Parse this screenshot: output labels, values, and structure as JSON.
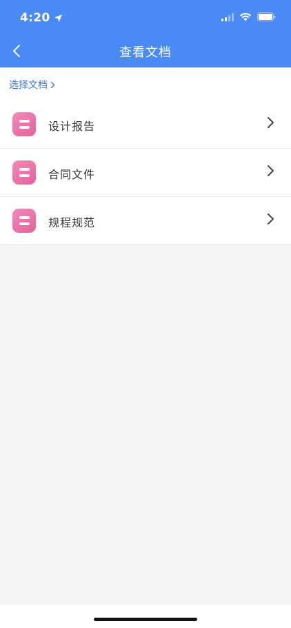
{
  "status_bar": {
    "time": "4:20",
    "location_icon": "location-arrow-icon",
    "signal_icon": "cellular-signal-icon",
    "wifi_icon": "wifi-icon",
    "battery_icon": "battery-icon"
  },
  "nav": {
    "back_icon": "chevron-left-icon",
    "title": "查看文档"
  },
  "breadcrumb": {
    "label": "选择文档",
    "icon": "chevron-right-icon"
  },
  "documents": [
    {
      "label": "设计报告",
      "icon": "document-list-icon"
    },
    {
      "label": "合同文件",
      "icon": "document-list-icon"
    },
    {
      "label": "规程规范",
      "icon": "document-list-icon"
    }
  ],
  "colors": {
    "header_blue": "#4a8af4",
    "link_blue": "#3a7bd5",
    "icon_pink": "#e8609c",
    "background": "#f5f5f6"
  }
}
